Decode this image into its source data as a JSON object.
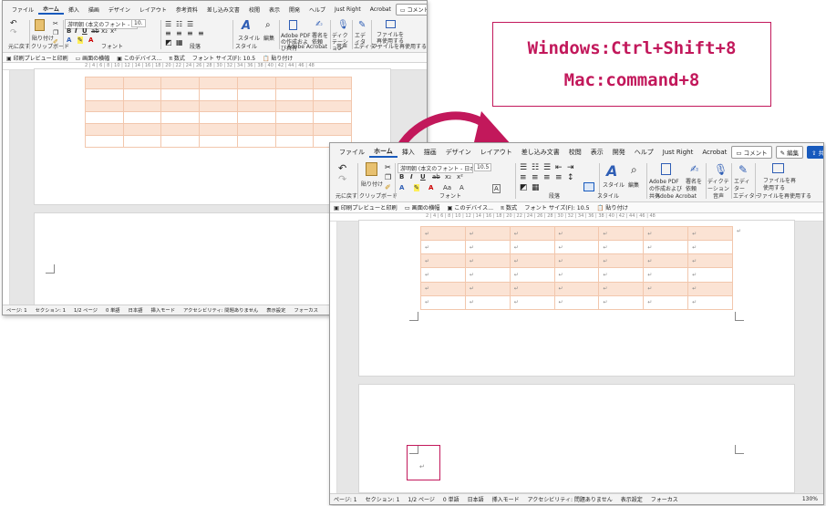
{
  "menu_tabs": [
    "ファイル",
    "ホーム",
    "挿入",
    "描画",
    "デザイン",
    "レイアウト",
    "参考資料",
    "差し込み文書",
    "校閲",
    "表示",
    "開発",
    "ヘルプ",
    "Just Right",
    "Acrobat"
  ],
  "menu_right": {
    "comment": "コメント",
    "edit": "編集",
    "share": "共有"
  },
  "ribbon": {
    "undo_label": "元に戻す",
    "clipboard_label": "クリップボード",
    "paste_label": "貼り付け",
    "font_label": "フォント",
    "paragraph_label": "段落",
    "style_label": "スタイル",
    "style_button": "スタイル",
    "edit_button": "編集",
    "adobe_pdf": "Adobe PDF の作成および共有",
    "sign_request": "署名を依頼",
    "adobe_acrobat_label": "Adobe Acrobat",
    "dictation": "ディクテーション",
    "voice_label": "音声",
    "editor": "エディター",
    "editor_label": "エディター",
    "reuse_file": "ファイルを再使用する",
    "reuse_label": "ファイルを再使用する",
    "font_name": "游明朝 (本文のフォント - 日本語",
    "font_size": "10.5",
    "font_size_w1": "10."
  },
  "qat": {
    "print_preview": "印刷プレビューと印刷",
    "screen_layout": "画面の横幅",
    "device": "このデバイス...",
    "format": "数式",
    "font_size_label": "フォント サイズ(F):",
    "font_size_value": "10.5",
    "paste": "貼り付け"
  },
  "ruler_ticks": "2 | 4 | 6 | 8 | 10 | 12 | 14 | 16 | 18 | 20 | 22 | 24 | 26 | 28 | 30 | 32 | 34 | 36 | 38 | 40 | 42 | 44 | 46 | 48",
  "paragraph_mark": "↵",
  "status_w1": {
    "page": "ページ: 1",
    "section": "セクション: 1",
    "pages": "1/2 ページ",
    "words": "0 単語",
    "lang": "日本語",
    "mode": "挿入モード",
    "accessibility": "アクセシビリティ: 問題ありません",
    "display": "表示設定",
    "focus": "フォーカス"
  },
  "status_w2": {
    "page": "ページ: 1",
    "section": "セクション: 1",
    "pages": "1/2 ページ",
    "words": "0 単語",
    "lang": "日本語",
    "mode": "挿入モード",
    "accessibility": "アクセシビリティ: 問題ありません",
    "display": "表示設定",
    "focus": "フォーカス",
    "zoom": "130%"
  },
  "shortcut": {
    "windows": "Windows:Ctrl+Shift+8",
    "mac": "Mac:command+8"
  },
  "colors": {
    "accent": "#c2185b",
    "word_blue": "#185abd",
    "table_shade": "#fbe3d4"
  }
}
